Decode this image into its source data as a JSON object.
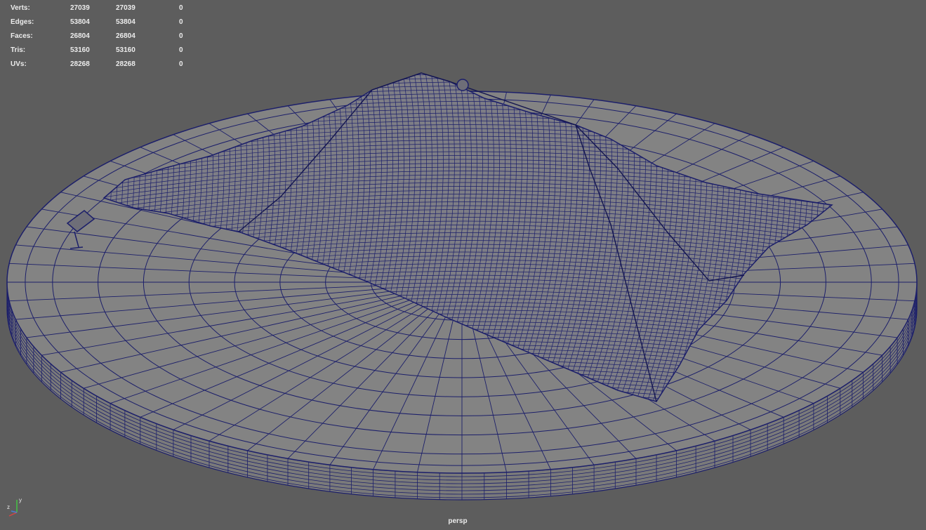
{
  "hud": {
    "rows": [
      {
        "label": "Verts:",
        "c1": "27039",
        "c2": "27039",
        "c3": "0"
      },
      {
        "label": "Edges:",
        "c1": "53804",
        "c2": "53804",
        "c3": "0"
      },
      {
        "label": "Faces:",
        "c1": "26804",
        "c2": "26804",
        "c3": "0"
      },
      {
        "label": "Tris:",
        "c1": "53160",
        "c2": "53160",
        "c3": "0"
      },
      {
        "label": "UVs:",
        "c1": "28268",
        "c2": "28268",
        "c3": "0"
      }
    ]
  },
  "camera": {
    "name": "persp"
  },
  "axis": {
    "y": "y",
    "z": "z"
  },
  "colors": {
    "background": "#5d5d5d",
    "wireframe": "#1c1f6a",
    "surface": "#838383",
    "rim": "#7a7a7a",
    "hud_text": "#ececec",
    "axis_x": "#d64545",
    "axis_y": "#45c545",
    "axis_z": "#4a7fd6"
  }
}
